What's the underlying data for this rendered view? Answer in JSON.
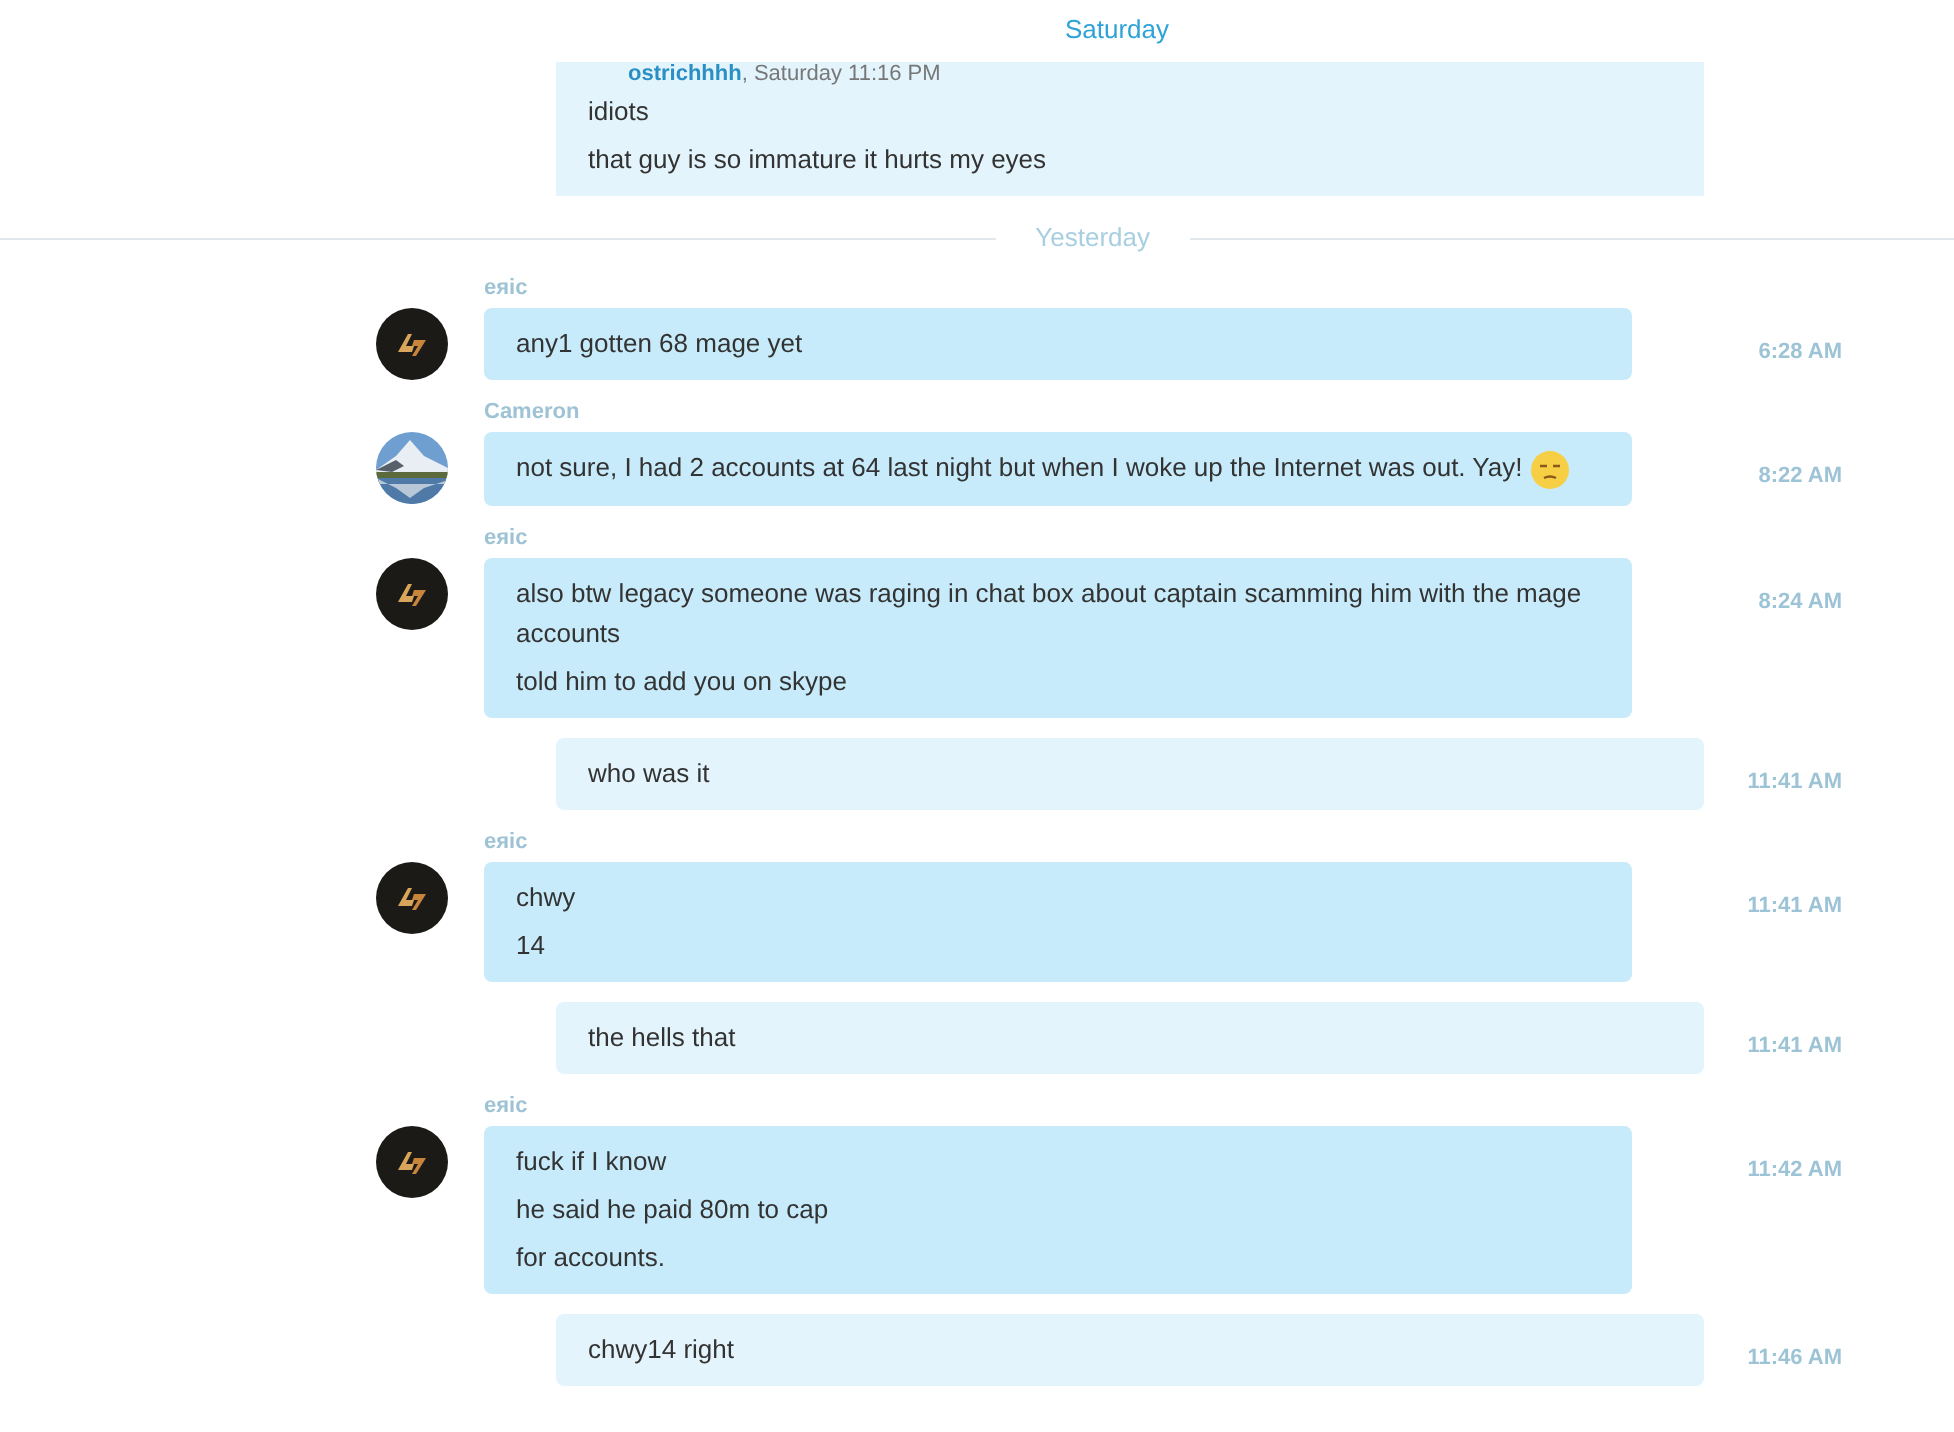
{
  "header": {
    "day": "Saturday"
  },
  "top_bubble": {
    "author": "ostrichhhh",
    "meta": ", Saturday 11:16 PM",
    "lines": [
      "idiots",
      "that guy is so immature it hurts my eyes"
    ]
  },
  "divider": "Yesterday",
  "messages": [
    {
      "kind": "incoming",
      "sender": "eяic",
      "avatar": {
        "kind": "logo"
      },
      "lines": [
        "any1 gotten 68 mage yet"
      ],
      "emoji": false,
      "time": "6:28 AM"
    },
    {
      "kind": "incoming",
      "sender": "Cameron",
      "avatar": {
        "kind": "photo"
      },
      "lines": [
        "not sure, I had 2 accounts at 64 last night but when I woke up the Internet was out. Yay!"
      ],
      "emoji": true,
      "time": "8:22 AM"
    },
    {
      "kind": "incoming",
      "sender": "eяic",
      "avatar": {
        "kind": "logo"
      },
      "lines": [
        "also btw legacy someone was raging in chat box about captain scamming him with the mage accounts",
        "told him to add you on skype"
      ],
      "emoji": false,
      "time": "8:24 AM"
    },
    {
      "kind": "outgoing",
      "lines": [
        "who was it"
      ],
      "emoji": false,
      "time": "11:41 AM"
    },
    {
      "kind": "incoming",
      "sender": "eяic",
      "avatar": {
        "kind": "logo"
      },
      "lines": [
        "chwy",
        "14"
      ],
      "emoji": false,
      "time": "11:41 AM"
    },
    {
      "kind": "outgoing",
      "lines": [
        "the hells that"
      ],
      "emoji": false,
      "time": "11:41 AM"
    },
    {
      "kind": "incoming",
      "sender": "eяic",
      "avatar": {
        "kind": "logo"
      },
      "lines": [
        "fuck if I know",
        "he said he paid 80m to cap",
        "for accounts."
      ],
      "emoji": false,
      "time": "11:42 AM"
    },
    {
      "kind": "outgoing",
      "lines": [
        "chwy14 right"
      ],
      "emoji": false,
      "time": "11:46 AM"
    }
  ]
}
